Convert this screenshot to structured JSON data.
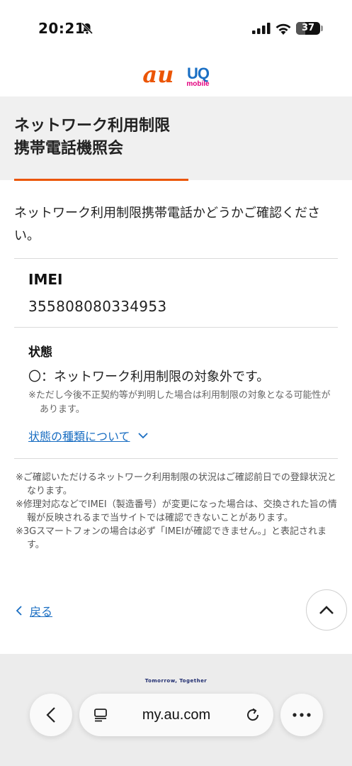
{
  "status_bar": {
    "time": "20:21",
    "battery_level": "37",
    "battery_fraction": 0.37,
    "icons": [
      "bell-off-icon",
      "signal-icon",
      "wifi-icon",
      "battery-icon"
    ]
  },
  "logos": {
    "au": "au",
    "uq": "UQ",
    "uq_sub": "mobile"
  },
  "page": {
    "title": "ネットワーク利用制限\n携帯電話機照会",
    "intro": "ネットワーク利用制限携帯電話かどうかご確認ください。"
  },
  "imei": {
    "label": "IMEI",
    "value": "355808080334953"
  },
  "status": {
    "label": "状態",
    "value": "〇：ネットワーク利用制限の対象外です。",
    "note": "※ただし今後不正契約等が判明した場合は利用制限の対象となる可能性があります。",
    "types_link": "状態の種類について"
  },
  "notes": [
    "※ご確認いただけるネットワーク利用制限の状況はご確認前日での登録状況となります。",
    "※修理対応などでIMEI（製造番号）が変更になった場合は、交換された旨の情報が反映されるまで当サイトでは確認できないことがあります。",
    "※3Gスマートフォンの場合は必ず「IMEIが確認できません。」と表記されます。"
  ],
  "back_link": "戻る",
  "footer": {
    "tagline": "Tomorrow, Together"
  },
  "browser": {
    "url": "my.au.com"
  },
  "colors": {
    "au_orange": "#eb5505",
    "link_blue": "#1a6ec2",
    "uq_blue": "#1a6fc4",
    "uq_pink": "#e3007f"
  }
}
